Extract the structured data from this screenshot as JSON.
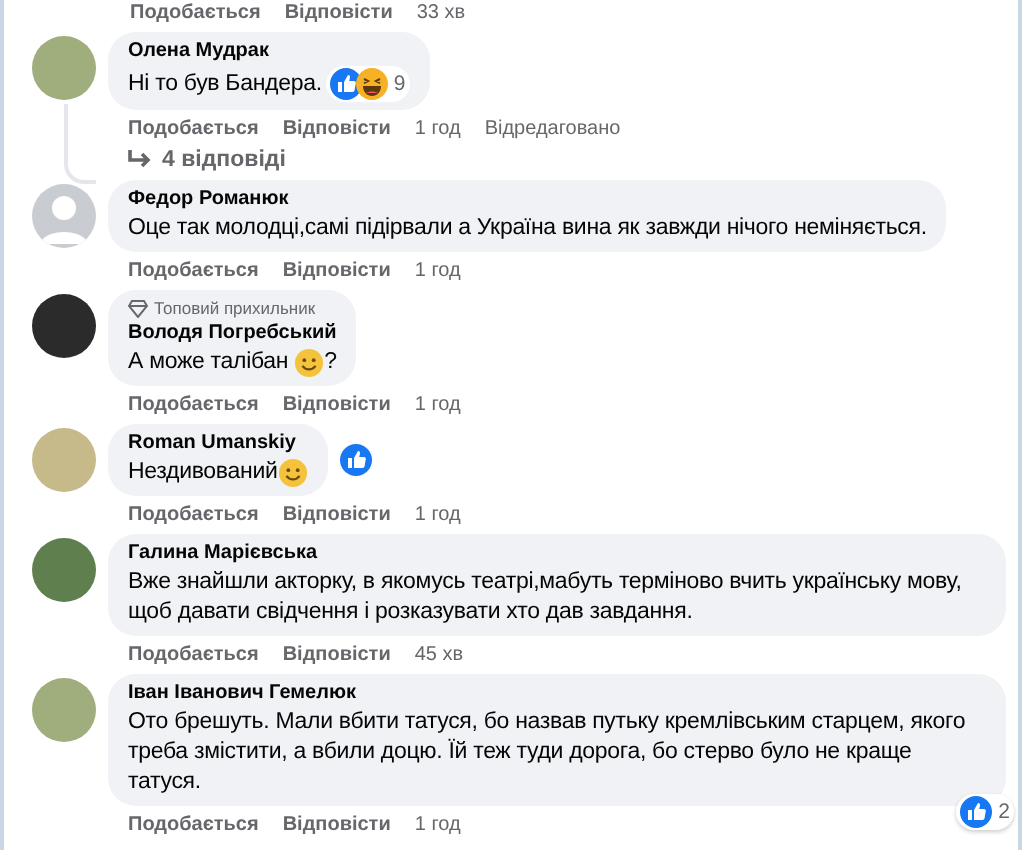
{
  "top_actions": {
    "like": "Подобається",
    "reply": "Відповісти",
    "time": "33 хв"
  },
  "comments": [
    {
      "author": "Олена Мудрак",
      "avatar": {
        "kind": "photo"
      },
      "body": [
        {
          "kind": "text",
          "text": "Ні то був Бандера."
        }
      ],
      "reactions": {
        "kind": "inline",
        "icons": [
          {
            "kind": "like"
          },
          {
            "kind": "haha"
          }
        ],
        "count": "9"
      },
      "actions": {
        "like": "Подобається",
        "reply": "Відповісти",
        "time": "1 год",
        "edited": "Відредаговано"
      },
      "replies": "4 відповіді"
    },
    {
      "author": "Федор Романюк",
      "avatar": {
        "kind": "default"
      },
      "body": [
        {
          "kind": "text",
          "text": "Оце так молодці,самі підірвали а Україна вина як завжди нічого неміняється."
        }
      ],
      "actions": {
        "like": "Подобається",
        "reply": "Відповісти",
        "time": "1 год"
      }
    },
    {
      "author": "Володя Погребський",
      "badge": "Топовий прихильник",
      "avatar": {
        "kind": "photo"
      },
      "body": [
        {
          "kind": "text",
          "text": "А може талібан "
        },
        {
          "kind": "emoji"
        },
        {
          "kind": "text",
          "text": "?"
        }
      ],
      "actions": {
        "like": "Подобається",
        "reply": "Відповісти",
        "time": "1 год"
      }
    },
    {
      "author": "Roman Umanskiy",
      "avatar": {
        "kind": "photo"
      },
      "body": [
        {
          "kind": "text",
          "text": "Нездивований"
        },
        {
          "kind": "emoji"
        }
      ],
      "reactions": {
        "kind": "side",
        "icons": [
          {
            "kind": "like"
          }
        ]
      },
      "actions": {
        "like": "Подобається",
        "reply": "Відповісти",
        "time": "1 год"
      }
    },
    {
      "author": "Галина Марієвська",
      "avatar": {
        "kind": "photo"
      },
      "body": [
        {
          "kind": "text",
          "text": "Вже знайшли акторку, в якомусь театрі,мабуть терміново вчить українську мову, щоб давати свідчення і розказувати хто дав завдання."
        }
      ],
      "actions": {
        "like": "Подобається",
        "reply": "Відповісти",
        "time": "45 хв"
      }
    },
    {
      "author": "Іван Іванович Гемелюк",
      "avatar": {
        "kind": "photo"
      },
      "body": [
        {
          "kind": "text",
          "text": "Ото брешуть. Мали вбити татуся, бо назвав путьку кремлівським старцем, якого треба змістити, а вбили доцю. Їй теж туди дорога, бо стерво було не краще татуся."
        }
      ],
      "reactions": {
        "kind": "corner",
        "icons": [
          {
            "kind": "like"
          }
        ],
        "count": "2"
      },
      "actions": {
        "like": "Подобається",
        "reply": "Відповісти",
        "time": "1 год"
      }
    }
  ]
}
